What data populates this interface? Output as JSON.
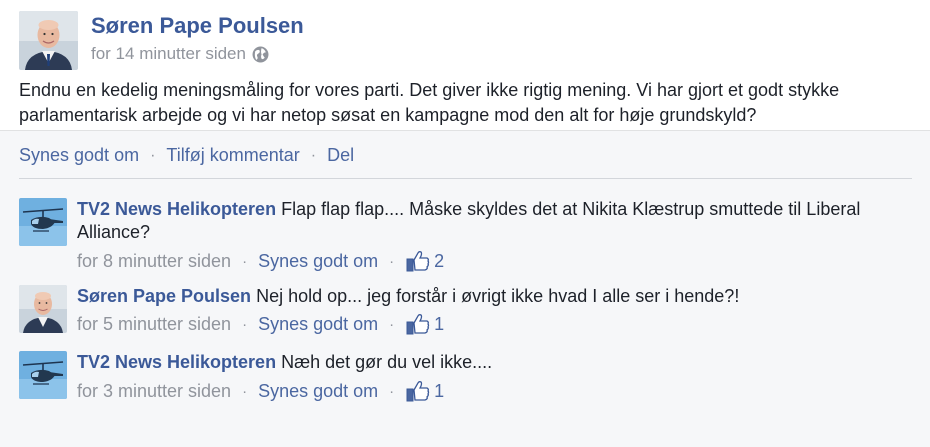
{
  "post": {
    "author": "Søren Pape Poulsen",
    "timestamp": "for 14 minutter siden",
    "privacy_icon": "globe-icon",
    "text": "Endnu en kedelig meningsmåling for vores parti. Det giver ikke rigtig mening. Vi har gjort et godt stykke parlamentarisk arbejde og vi har netop søsat en kampagne mod den alt for høje grundskyld?"
  },
  "actions": {
    "like": "Synes godt om",
    "comment": "Tilføj kommentar",
    "share": "Del",
    "separator": "·"
  },
  "comments": [
    {
      "author": "TV2 News Helikopteren",
      "text": "Flap flap flap....  Måske skyldes det at Nikita Klæstrup smuttede til Liberal Alliance?",
      "time": "for 8 minutter siden",
      "like_label": "Synes godt om",
      "likes": "2",
      "avatar": "helicopter-avatar"
    },
    {
      "author": "Søren Pape Poulsen",
      "text": "Nej hold op... jeg forstår i øvrigt ikke hvad I alle ser i hende?!",
      "time": "for 5 minutter siden",
      "like_label": "Synes godt om",
      "likes": "1",
      "avatar": "person-avatar"
    },
    {
      "author": "TV2 News Helikopteren",
      "text": "Næh det gør du vel ikke....",
      "time": "for 3 minutter siden",
      "like_label": "Synes godt om",
      "likes": "1",
      "avatar": "helicopter-avatar"
    }
  ],
  "colors": {
    "link": "#3b5998",
    "meta": "#90949c",
    "feedback_bg": "#f6f7f9"
  }
}
